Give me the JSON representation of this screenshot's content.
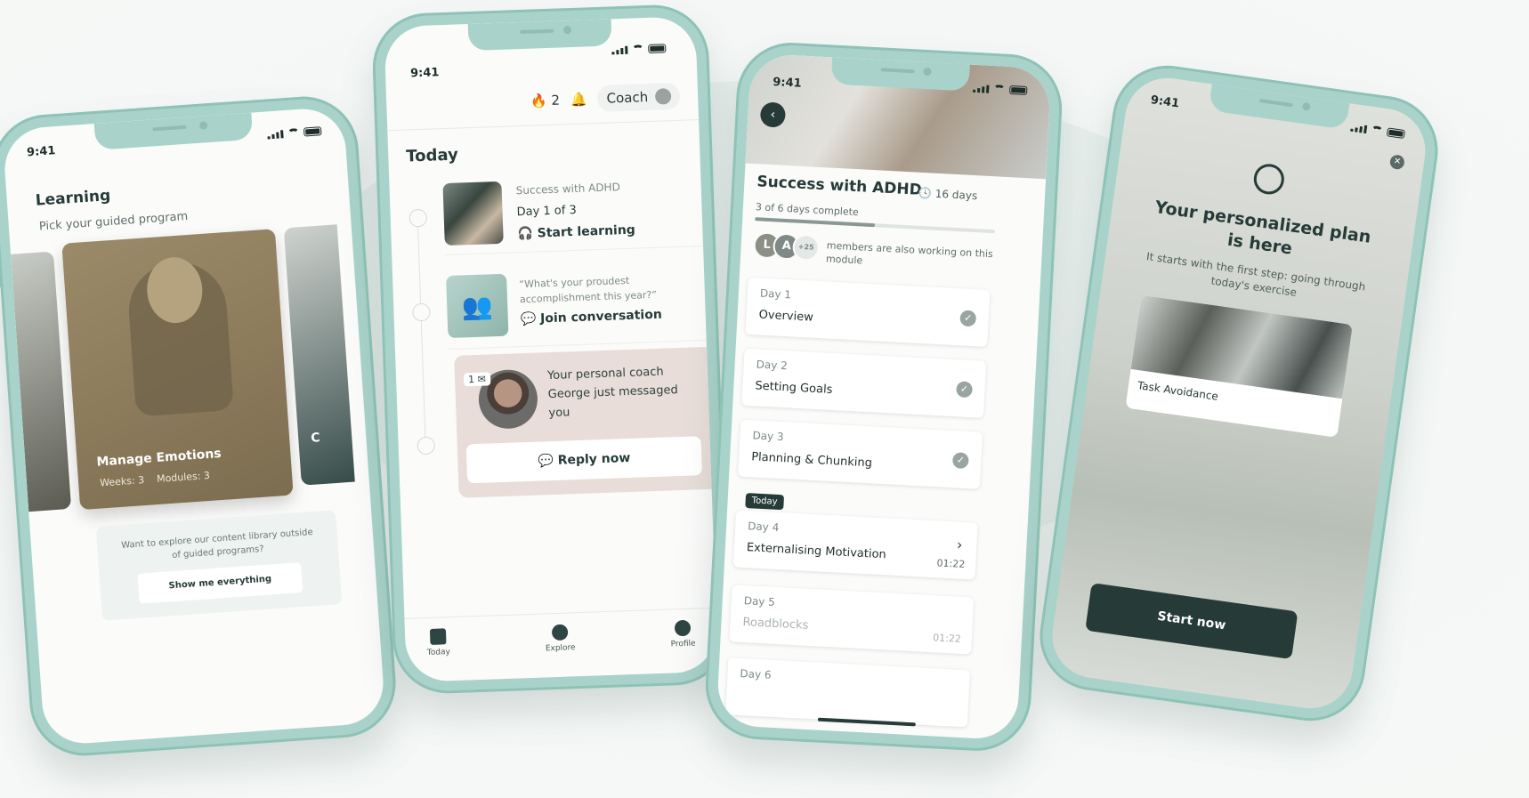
{
  "status": {
    "time": "9:41"
  },
  "learning": {
    "title": "Learning",
    "subtitle": "Pick your guided program",
    "card": {
      "title": "Manage Emotions",
      "weeks": "Weeks: 3",
      "modules": "Modules: 3"
    },
    "next_card_initial": "C",
    "explore_text": "Want to explore our content library outside of guided programs?",
    "explore_button": "Show me everything"
  },
  "today": {
    "streak": "2",
    "coach_label": "Coach",
    "title": "Today",
    "item1": {
      "eyebrow": "Success with ADHD",
      "progress": "Day 1 of 3",
      "action": "Start learning"
    },
    "item2": {
      "question": "“What's your proudest accomplishment this year?”",
      "action": "Join conversation"
    },
    "coach_card": {
      "badge": "1",
      "message": "Your personal coach George just messaged you",
      "action": "Reply now"
    },
    "tabs": [
      {
        "label": "Today"
      },
      {
        "label": "Explore"
      },
      {
        "label": "Profile"
      }
    ]
  },
  "module": {
    "title": "Success with ADHD",
    "duration": "16 days",
    "progress_text": "3 of 6 days complete",
    "progress_fraction": 0.5,
    "avatars": [
      "L",
      "A"
    ],
    "avatars_more": "+25",
    "members_text": "members are also working on this module",
    "today_tag": "Today",
    "days": [
      {
        "label": "Day 1",
        "name": "Overview"
      },
      {
        "label": "Day 2",
        "name": "Setting Goals"
      },
      {
        "label": "Day 3",
        "name": "Planning & Chunking"
      },
      {
        "label": "Day 4",
        "name": "Externalising Motivation",
        "duration": "01:22"
      },
      {
        "label": "Day 5",
        "name": "Roadblocks",
        "duration": "01:22"
      },
      {
        "label": "Day 6"
      }
    ]
  },
  "plan": {
    "title": "Your personalized plan is here",
    "subtitle": "It starts with the first step: going through today's exercise",
    "exercise": "Task Avoidance",
    "button": "Start now"
  }
}
